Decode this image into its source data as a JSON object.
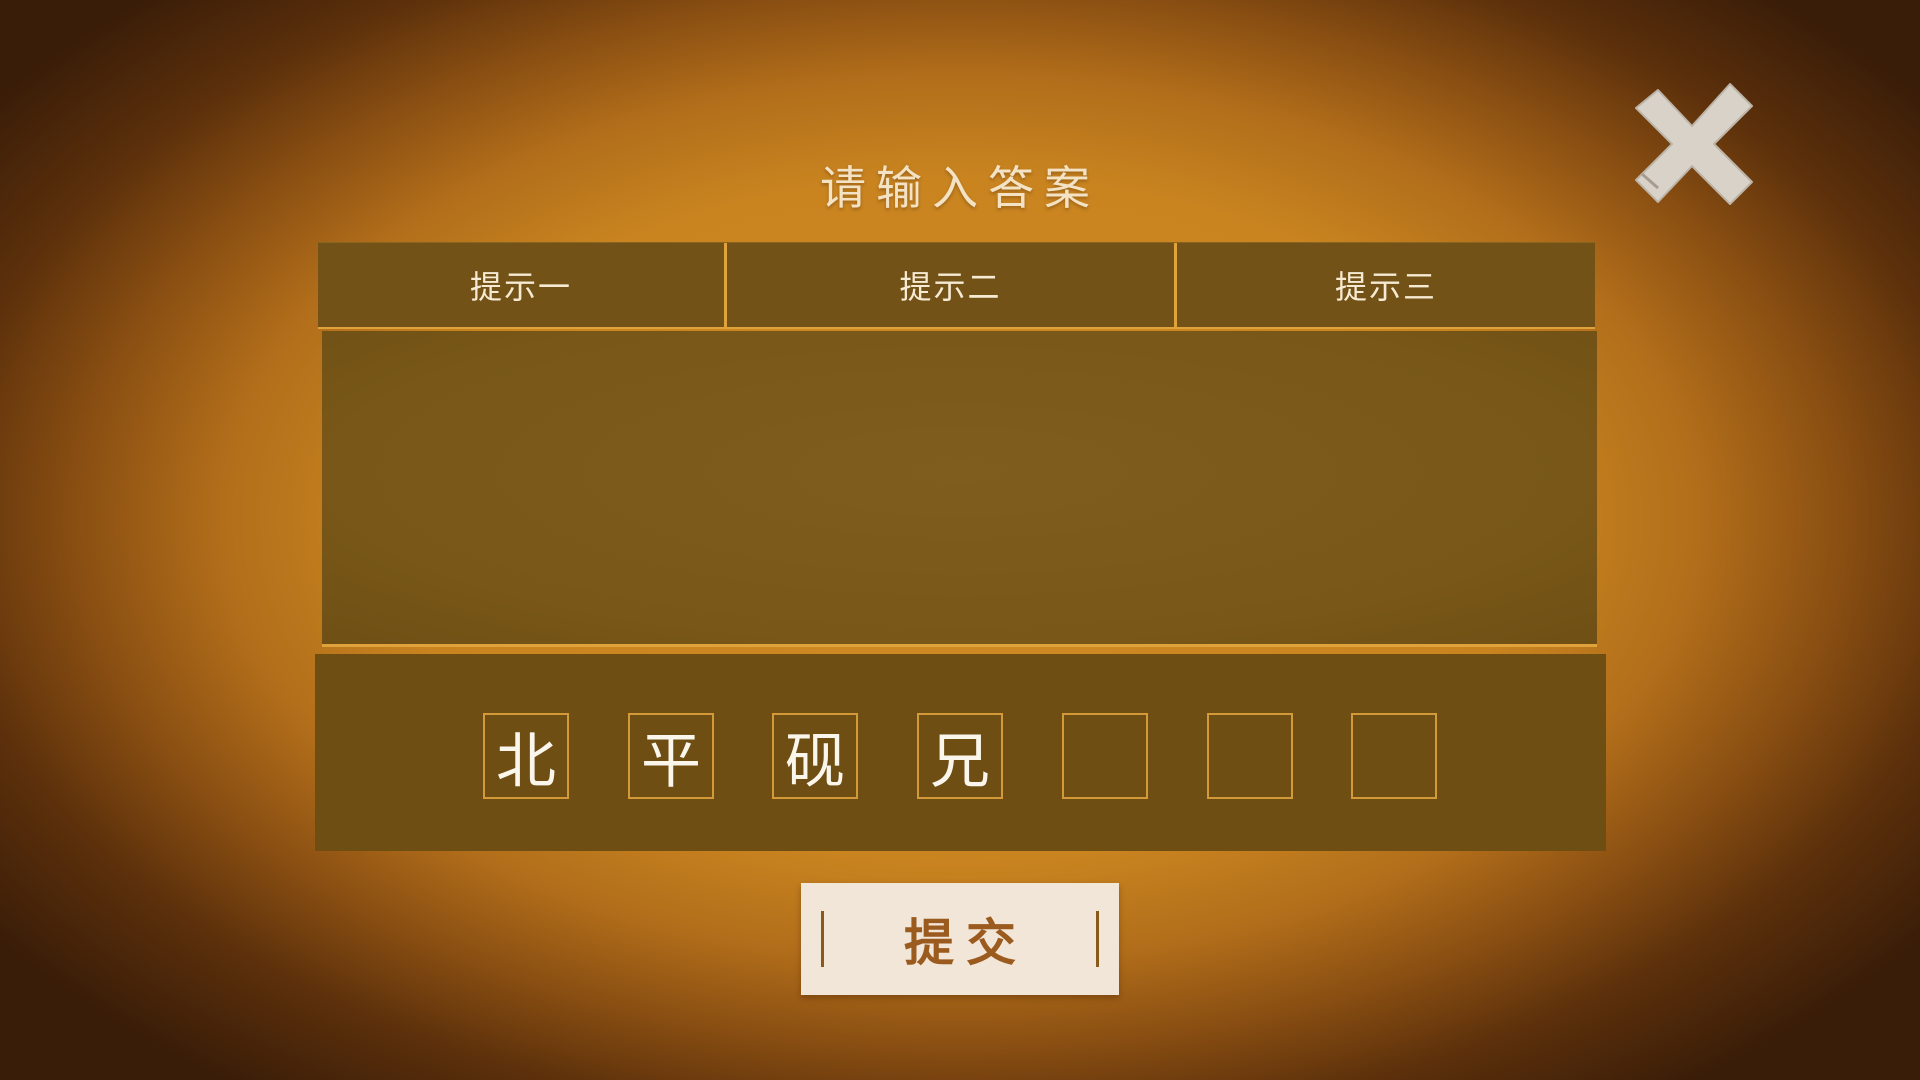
{
  "dialog": {
    "title": "请输入答案",
    "close_icon": "close-x-icon"
  },
  "hint_tabs": [
    {
      "label": "提示一"
    },
    {
      "label": "提示二"
    },
    {
      "label": "提示三"
    }
  ],
  "hint_content": "",
  "answer_slots": [
    {
      "char": "北"
    },
    {
      "char": "平"
    },
    {
      "char": "砚"
    },
    {
      "char": "兄"
    },
    {
      "char": ""
    },
    {
      "char": ""
    },
    {
      "char": ""
    }
  ],
  "submit": {
    "label": "提交"
  },
  "colors": {
    "background_glow": "#d08a26",
    "panel": "#735217",
    "border_accent": "#e0a23a",
    "button_bg": "#f1e6d8",
    "button_text": "#9b5a1e"
  }
}
